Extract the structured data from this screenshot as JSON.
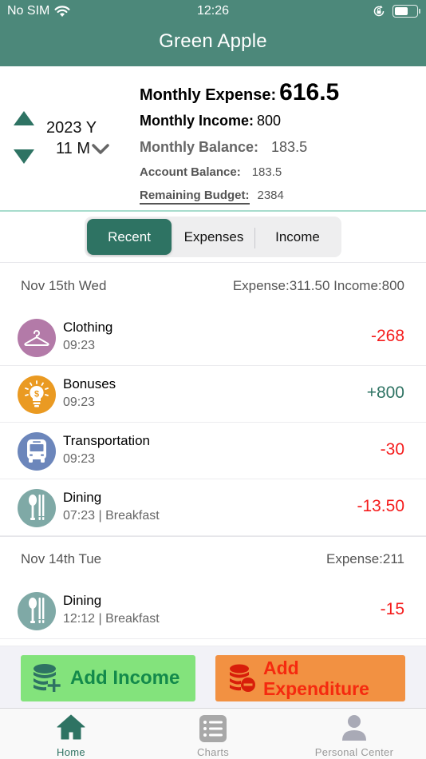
{
  "status_bar": {
    "carrier": "No SIM",
    "time": "12:26",
    "battery_level": 0.62
  },
  "header": {
    "title": "Green Apple"
  },
  "period": {
    "year": "2023 Y",
    "month": "11 M"
  },
  "summary": {
    "monthly_expense_label": "Monthly Expense:",
    "monthly_expense_value": "616.5",
    "monthly_income_label": "Monthly Income:",
    "monthly_income_value": "800",
    "monthly_balance_label": "Monthly Balance:",
    "monthly_balance_value": "183.5",
    "account_balance_label": "Account Balance:",
    "account_balance_value": "183.5",
    "remaining_budget_label": "Remaining Budget:",
    "remaining_budget_value": "2384"
  },
  "segments": {
    "active": 0,
    "tabs": [
      {
        "label": "Recent"
      },
      {
        "label": "Expenses"
      },
      {
        "label": "Income"
      }
    ]
  },
  "groups": [
    {
      "date": "Nov 15th  Wed",
      "totals": "Expense:311.50 Income:800",
      "items": [
        {
          "category": "Clothing",
          "sub": "09:23",
          "amount": "-268",
          "type": "expense",
          "icon": "hanger-icon",
          "color": "#b37aa8"
        },
        {
          "category": "Bonuses",
          "sub": "09:23",
          "amount": "+800",
          "type": "income",
          "icon": "lightbulb-dollar-icon",
          "color": "#ea9a22"
        },
        {
          "category": "Transportation",
          "sub": "09:23",
          "amount": "-30",
          "type": "expense",
          "icon": "bus-icon",
          "color": "#6c86bb"
        },
        {
          "category": "Dining",
          "sub": "07:23 | Breakfast",
          "amount": "-13.50",
          "type": "expense",
          "icon": "spoon-chopsticks-icon",
          "color": "#7fa9a6"
        }
      ]
    },
    {
      "date": "Nov 14th  Tue",
      "totals": "Expense:211",
      "items": [
        {
          "category": "Dining",
          "sub": "12:12 | Breakfast",
          "amount": "-15",
          "type": "expense",
          "icon": "spoon-chopsticks-icon",
          "color": "#7fa9a6"
        }
      ]
    }
  ],
  "actions": {
    "add_income": "Add Income",
    "add_expenditure": "Add Expenditure"
  },
  "tabbar": {
    "active": "Home",
    "items": [
      {
        "label": "Home"
      },
      {
        "label": "Charts"
      },
      {
        "label": "Personal Center"
      }
    ]
  },
  "colors": {
    "brand": "#4c887a",
    "accent": "#2e7363",
    "expense": "#f51c1c",
    "income": "#2e7363"
  }
}
